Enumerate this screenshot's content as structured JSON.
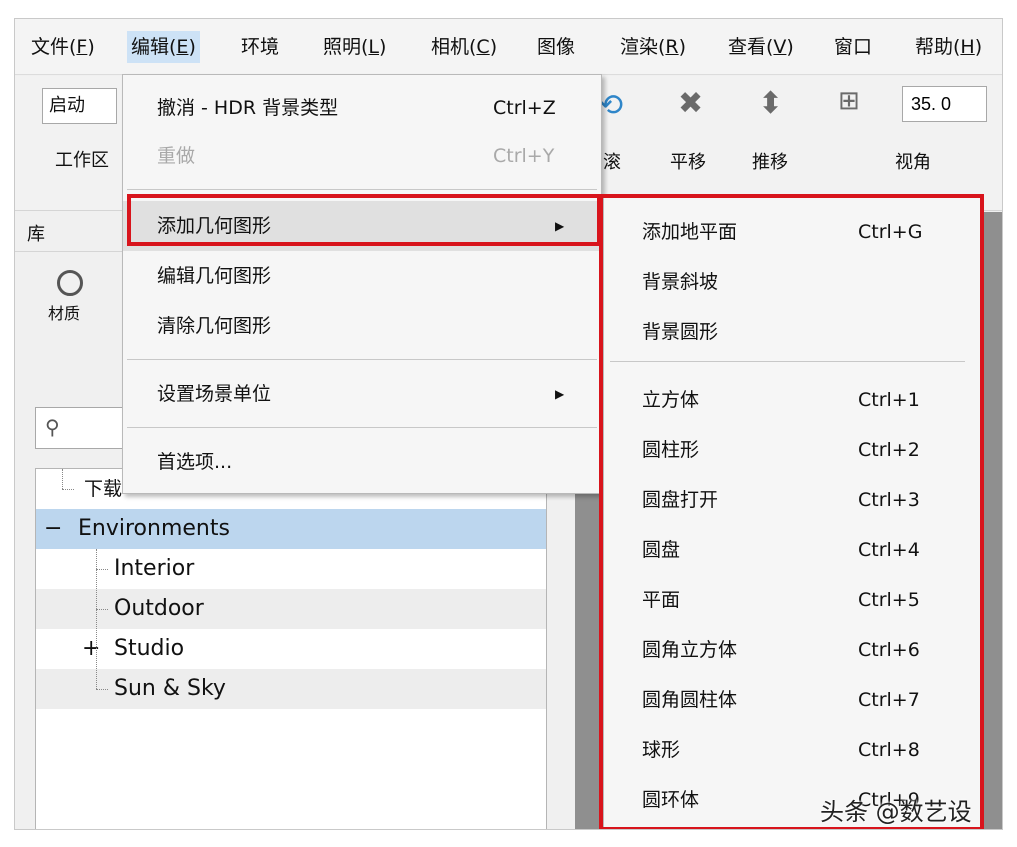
{
  "menubar": {
    "items": [
      {
        "label": "文件(",
        "key": "F",
        "end": ")"
      },
      {
        "label": "编辑(",
        "key": "E",
        "end": ")"
      },
      {
        "label": "环境",
        "key": "",
        "end": ""
      },
      {
        "label": "照明(",
        "key": "L",
        "end": ")"
      },
      {
        "label": "相机(",
        "key": "C",
        "end": ")"
      },
      {
        "label": "图像",
        "key": "",
        "end": ""
      },
      {
        "label": "渲染(",
        "key": "R",
        "end": ")"
      },
      {
        "label": "查看(",
        "key": "V",
        "end": ")"
      },
      {
        "label": "窗口",
        "key": "",
        "end": ""
      },
      {
        "label": "帮助(",
        "key": "H",
        "end": ")"
      }
    ]
  },
  "toolbar": {
    "startup": "启动",
    "workspace": "工作区",
    "tool_partial": "滚",
    "pan": "平移",
    "push": "推移",
    "fov": "视角",
    "fov_value": "35. 0"
  },
  "library": {
    "title": "库",
    "material": "材质",
    "tree": {
      "download": "下载",
      "environments": "Environments",
      "interior": "Interior",
      "outdoor": "Outdoor",
      "studio": "Studio",
      "sun_sky": "Sun & Sky",
      "collapse": "−",
      "expand": "+"
    }
  },
  "edit_menu": {
    "undo": {
      "label": "撤消 - HDR 背景类型",
      "shortcut": "Ctrl+Z"
    },
    "redo": {
      "label": "重做",
      "shortcut": "Ctrl+Y"
    },
    "add_geometry": "添加几何图形",
    "edit_geometry": "编辑几何图形",
    "clear_geometry": "清除几何图形",
    "scene_units": "设置场景单位",
    "preferences": "首选项..."
  },
  "submenu": {
    "items_top": [
      {
        "label": "添加地平面",
        "shortcut": "Ctrl+G"
      },
      {
        "label": "背景斜坡",
        "shortcut": ""
      },
      {
        "label": "背景圆形",
        "shortcut": ""
      }
    ],
    "items": [
      {
        "label": "立方体",
        "shortcut": "Ctrl+1"
      },
      {
        "label": "圆柱形",
        "shortcut": "Ctrl+2"
      },
      {
        "label": "圆盘打开",
        "shortcut": "Ctrl+3"
      },
      {
        "label": "圆盘",
        "shortcut": "Ctrl+4"
      },
      {
        "label": "平面",
        "shortcut": "Ctrl+5"
      },
      {
        "label": "圆角立方体",
        "shortcut": "Ctrl+6"
      },
      {
        "label": "圆角圆柱体",
        "shortcut": "Ctrl+7"
      },
      {
        "label": "球形",
        "shortcut": "Ctrl+8"
      },
      {
        "label": "圆环体",
        "shortcut": "Ctrl+9"
      }
    ]
  },
  "watermark": "头条 @数艺设",
  "colors": {
    "highlight": "#d8141c",
    "selection": "#bcd6ee",
    "menu_active": "#cde2f6"
  }
}
